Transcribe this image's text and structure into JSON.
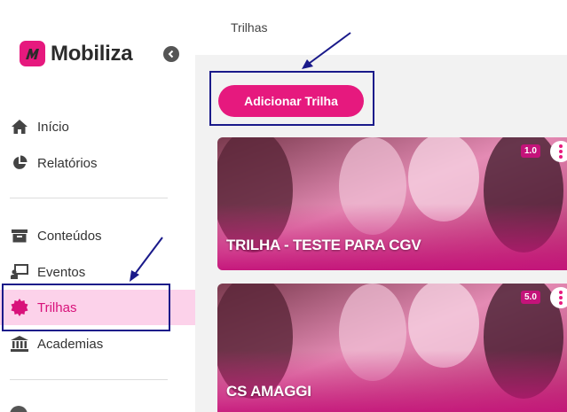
{
  "brand": {
    "name": "Mobiliza",
    "color": "#e6197e"
  },
  "sidebar": {
    "items": [
      {
        "label": "Início",
        "icon": "home-icon"
      },
      {
        "label": "Relatórios",
        "icon": "pie-chart-icon"
      },
      {
        "label": "Conteúdos",
        "icon": "archive-icon"
      },
      {
        "label": "Eventos",
        "icon": "presentation-icon"
      },
      {
        "label": "Trilhas",
        "icon": "badge-icon",
        "active": true
      },
      {
        "label": "Academias",
        "icon": "institution-icon"
      }
    ]
  },
  "header": {
    "title": "Trilhas"
  },
  "toolbar": {
    "add_label": "Adicionar Trilha"
  },
  "trails": [
    {
      "title": "TRILHA - TESTE PARA CGV",
      "version": "1.0"
    },
    {
      "title": "CS AMAGGI",
      "version": "5.0"
    }
  ]
}
